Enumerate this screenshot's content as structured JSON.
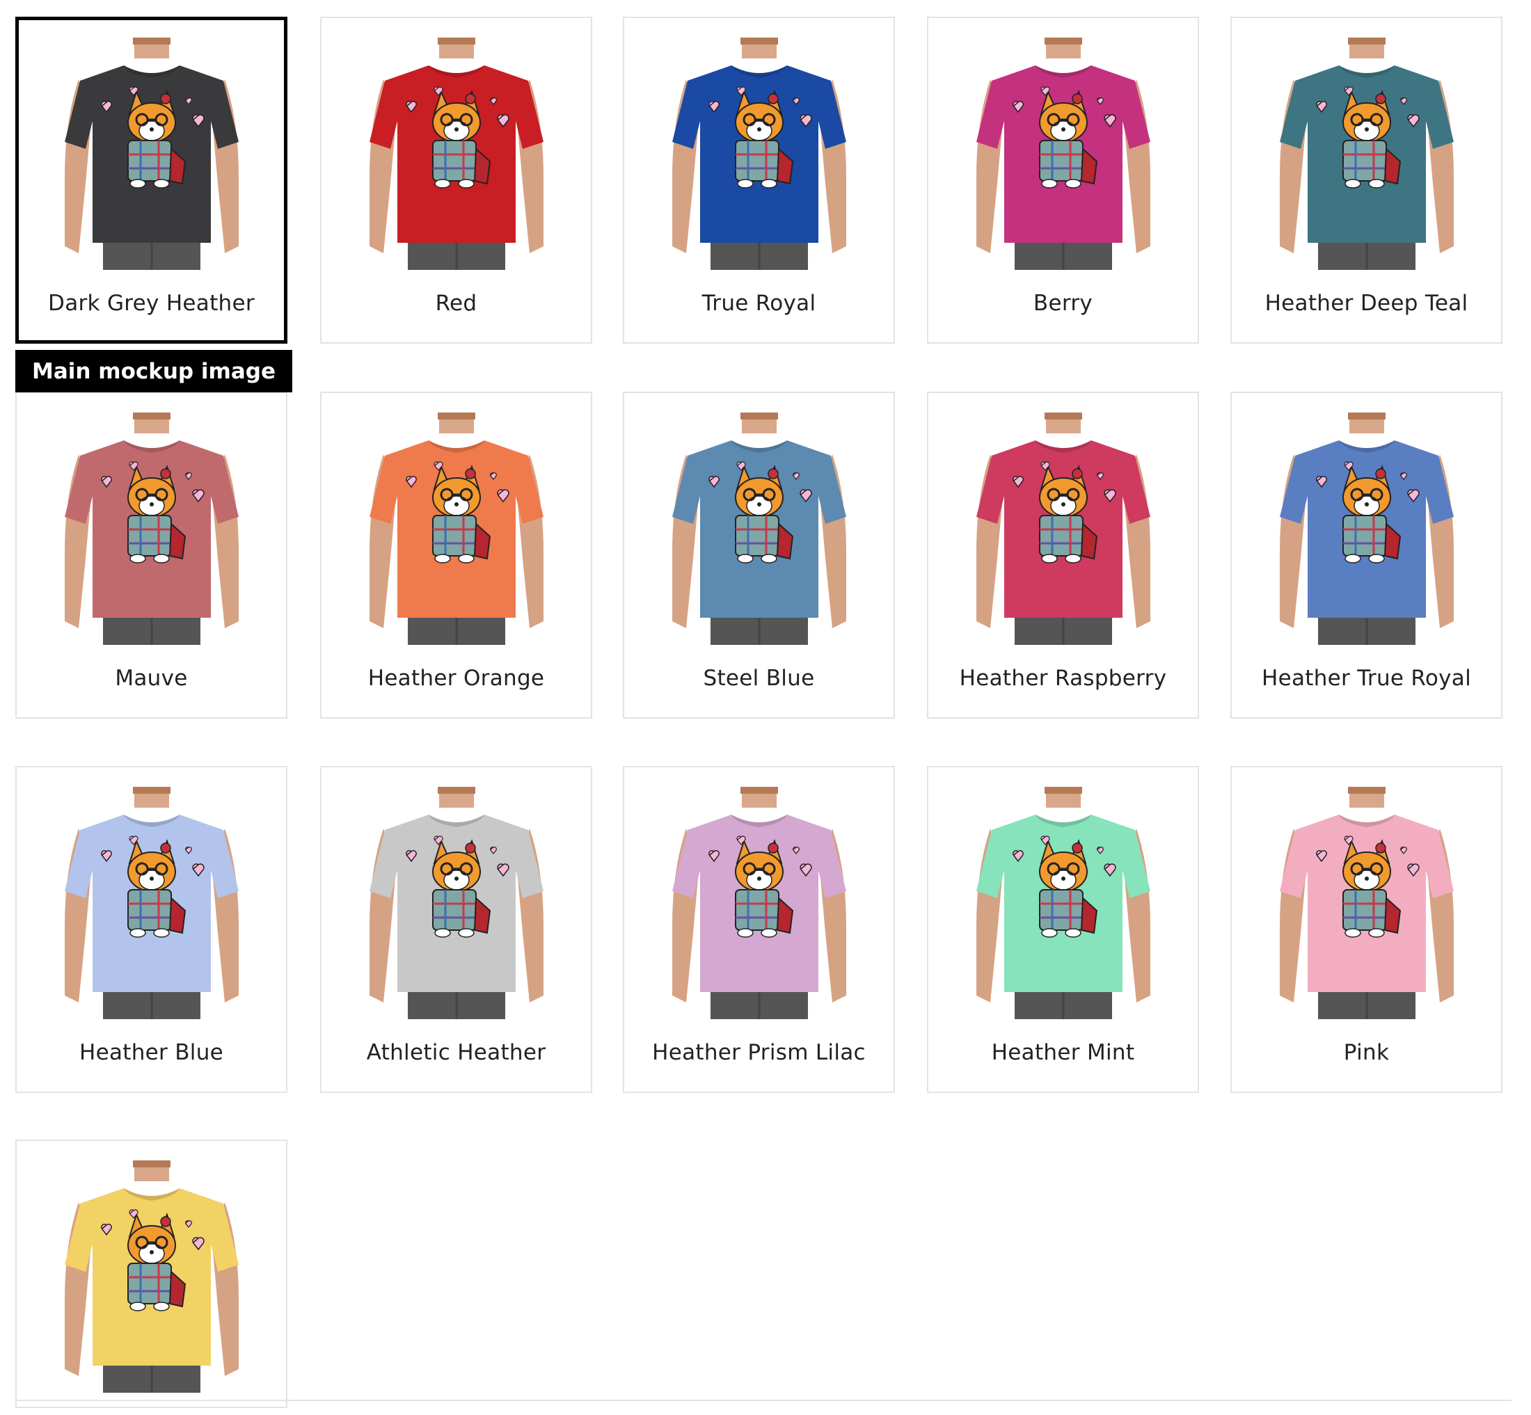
{
  "main_badge": "Main mockup image",
  "selected_index": 0,
  "mockups": [
    {
      "label": "Dark Grey Heather",
      "shirt": "#3a3a3c"
    },
    {
      "label": "Red",
      "shirt": "#c81e24"
    },
    {
      "label": "True Royal",
      "shirt": "#1a4aa3"
    },
    {
      "label": "Berry",
      "shirt": "#c4317f"
    },
    {
      "label": "Heather Deep Teal",
      "shirt": "#3e7583"
    },
    {
      "label": "Mauve",
      "shirt": "#c06a6e"
    },
    {
      "label": "Heather Orange",
      "shirt": "#ef7a4c"
    },
    {
      "label": "Steel Blue",
      "shirt": "#5d8ab0"
    },
    {
      "label": "Heather Raspberry",
      "shirt": "#cf3a5f"
    },
    {
      "label": "Heather True Royal",
      "shirt": "#5a7ec2"
    },
    {
      "label": "Heather Blue",
      "shirt": "#b2c4ec"
    },
    {
      "label": "Athletic Heather",
      "shirt": "#c8c8c8"
    },
    {
      "label": "Heather Prism Lilac",
      "shirt": "#d4a8d0"
    },
    {
      "label": "Heather Mint",
      "shirt": "#86e3bb"
    },
    {
      "label": "Pink",
      "shirt": "#f2aec0"
    },
    {
      "label": "",
      "shirt": "#f2d165"
    }
  ]
}
